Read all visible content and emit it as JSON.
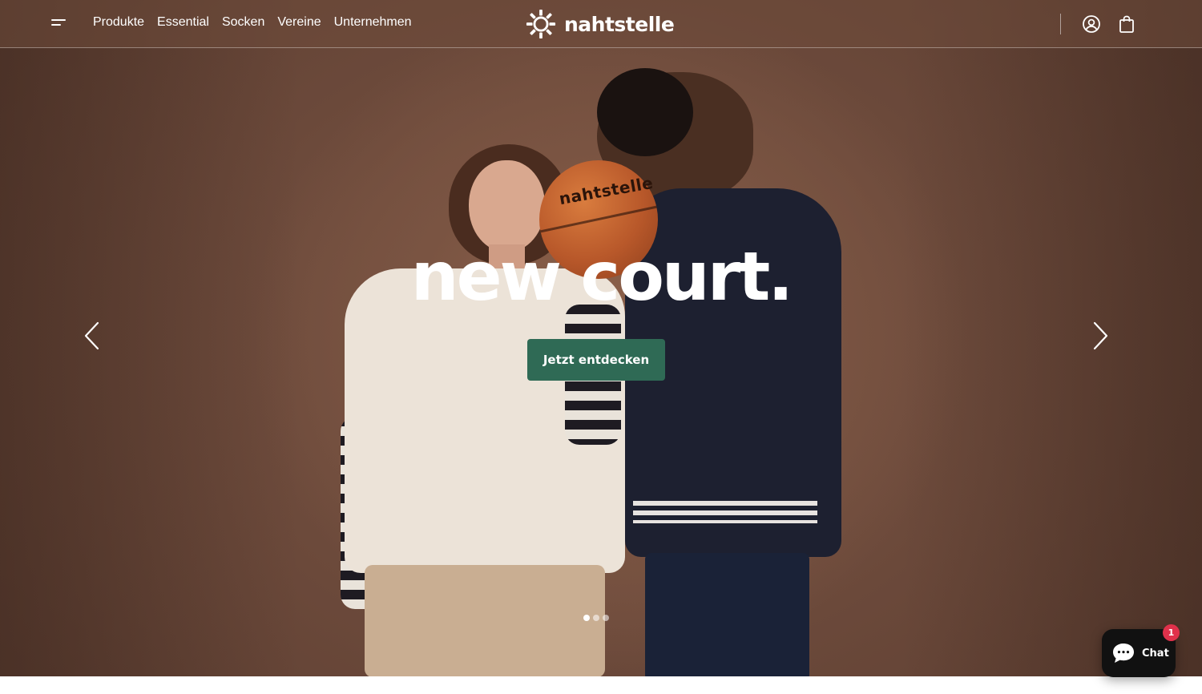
{
  "header": {
    "menu_icon": "hamburger-menu-icon",
    "nav": [
      {
        "label": "Produkte"
      },
      {
        "label": "Essential"
      },
      {
        "label": "Socken"
      },
      {
        "label": "Vereine"
      },
      {
        "label": "Unternehmen"
      }
    ],
    "logo_text": "nahtstelle",
    "account_icon": "user-circle-icon",
    "cart_icon": "shopping-bag-icon"
  },
  "hero": {
    "headline": "new court.",
    "cta_label": "Jetzt entdecken",
    "ball_text": "nahtstelle",
    "prev_icon": "chevron-left-icon",
    "next_icon": "chevron-right-icon",
    "slides_total": 3,
    "active_slide": 1
  },
  "chat": {
    "label": "Chat",
    "badge": "1",
    "icon": "chat-bubble-icon"
  },
  "colors": {
    "cta_bg": "#2f6a55",
    "badge_bg": "#e0314b",
    "hero_bg": "#7c5645"
  }
}
